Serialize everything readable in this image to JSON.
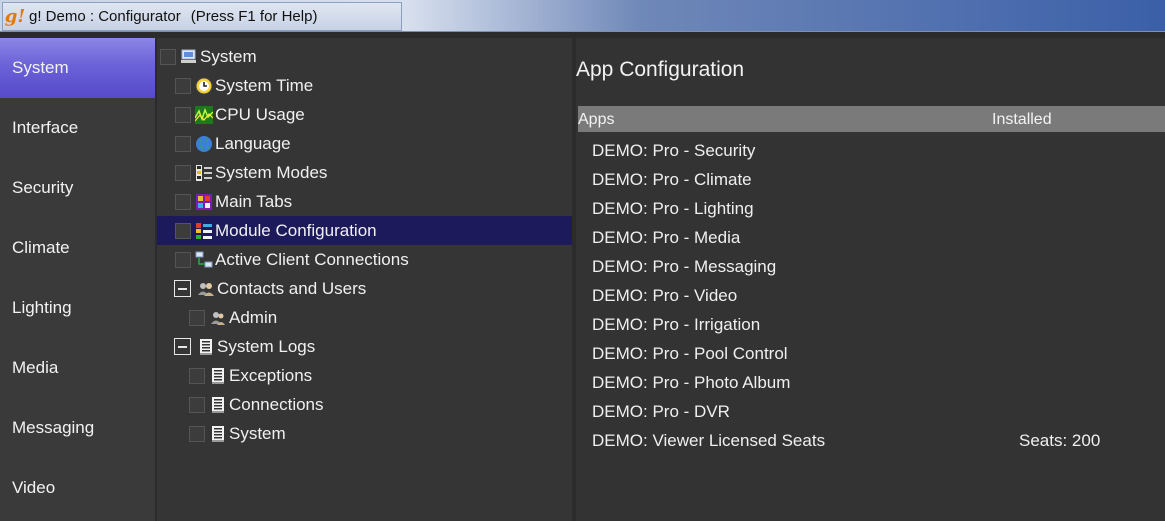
{
  "window": {
    "title": "g! Demo : Configurator",
    "hint": "(Press F1 for Help)",
    "logo_text": "g!"
  },
  "nav": {
    "items": [
      {
        "label": "System",
        "active": true
      },
      {
        "label": "Interface"
      },
      {
        "label": "Security"
      },
      {
        "label": "Climate"
      },
      {
        "label": "Lighting"
      },
      {
        "label": "Media"
      },
      {
        "label": "Messaging"
      },
      {
        "label": "Video"
      }
    ]
  },
  "tree": {
    "items": [
      {
        "label": "System",
        "icon": "computer-icon"
      },
      {
        "label": "System Time",
        "icon": "clock-icon"
      },
      {
        "label": "CPU Usage",
        "icon": "cpu-graph-icon"
      },
      {
        "label": "Language",
        "icon": "globe-icon"
      },
      {
        "label": "System Modes",
        "icon": "modes-icon"
      },
      {
        "label": "Main Tabs",
        "icon": "tabs-icon"
      },
      {
        "label": "Module Configuration",
        "icon": "modules-icon",
        "selected": true
      },
      {
        "label": "Active Client Connections",
        "icon": "network-icon"
      },
      {
        "label": "Contacts and Users",
        "icon": "users-icon",
        "expanded": true
      },
      {
        "label": "Admin",
        "icon": "user-icon"
      },
      {
        "label": "System Logs",
        "icon": "log-icon",
        "expanded": true
      },
      {
        "label": "Exceptions",
        "icon": "log-icon"
      },
      {
        "label": "Connections",
        "icon": "log-icon"
      },
      {
        "label": "System",
        "icon": "log-icon"
      }
    ]
  },
  "content": {
    "title": "App Configuration",
    "columns": {
      "apps": "Apps",
      "installed": "Installed"
    },
    "rows": [
      {
        "name": "DEMO: Pro - Security",
        "installed": ""
      },
      {
        "name": "DEMO: Pro - Climate",
        "installed": ""
      },
      {
        "name": "DEMO: Pro - Lighting",
        "installed": ""
      },
      {
        "name": "DEMO: Pro - Media",
        "installed": ""
      },
      {
        "name": "DEMO: Pro - Messaging",
        "installed": ""
      },
      {
        "name": "DEMO: Pro - Video",
        "installed": ""
      },
      {
        "name": "DEMO: Pro - Irrigation",
        "installed": ""
      },
      {
        "name": "DEMO: Pro - Pool Control",
        "installed": ""
      },
      {
        "name": "DEMO: Pro - Photo Album",
        "installed": ""
      },
      {
        "name": "DEMO: Pro - DVR",
        "installed": ""
      },
      {
        "name": "DEMO: Viewer Licensed Seats",
        "installed": "Seats: 200"
      }
    ]
  },
  "colors": {
    "nav_active": "#6b62d8",
    "tree_selected": "#1d1a5c",
    "table_header": "#7a7a7a"
  }
}
